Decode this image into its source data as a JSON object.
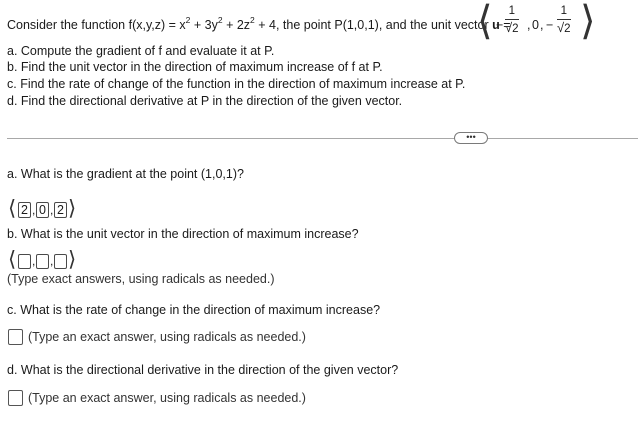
{
  "problem": {
    "intro_prefix": "Consider the function f(x,y,z) = x",
    "exp1": "2",
    "mid1": " + 3y",
    "exp2": "2",
    "mid2": " + 2z",
    "exp3": "2",
    "intro_suffix": " + 4, the point P(1,0,1), and the unit vector ",
    "u_label": "u",
    "equals": " =",
    "vector": {
      "c1_sign": "−",
      "c1_num": "1",
      "c1_den": "2",
      "c2": "0",
      "c3_sign": "−",
      "c3_num": "1",
      "c3_den": "2"
    },
    "parts": [
      "a. Compute the gradient of f and evaluate it at P.",
      "b. Find the unit vector in the direction of maximum increase of f at P.",
      "c. Find the rate of change of the function in the direction of maximum increase at P.",
      "d. Find the directional derivative at P in the direction of the given vector."
    ]
  },
  "more_button_label": "•••",
  "questions": {
    "a": {
      "prompt": "a. What is the gradient at the point (1,0,1)?",
      "answer": [
        "2",
        "0",
        "2"
      ]
    },
    "b": {
      "prompt": "b. What is the unit vector in the direction of maximum increase?",
      "hint": "(Type exact answers, using radicals as needed.)"
    },
    "c": {
      "prompt": "c. What is the rate of change in the direction of maximum increase?",
      "hint": "(Type an exact answer, using radicals as needed.)"
    },
    "d": {
      "prompt": "d. What is the directional derivative in the direction of the given vector?",
      "hint": "(Type an exact answer, using radicals as needed.)"
    }
  }
}
